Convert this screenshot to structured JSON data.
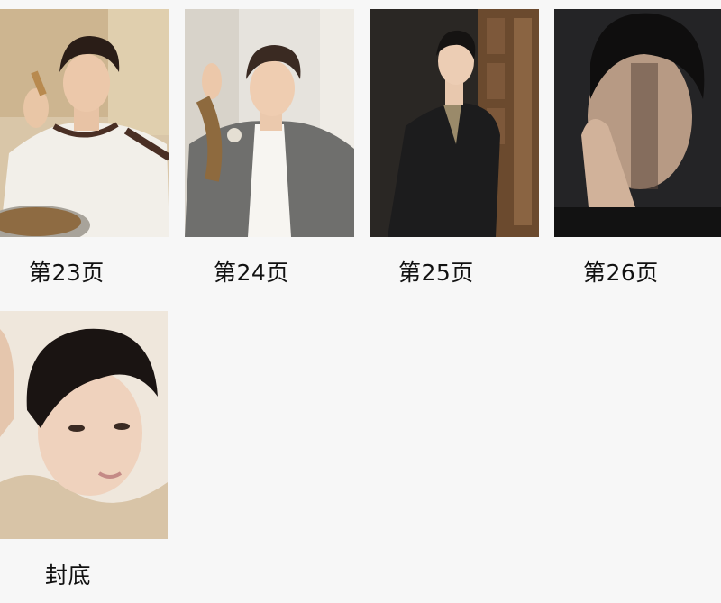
{
  "pages": [
    {
      "label": "第23页",
      "photo": "page-23-photo"
    },
    {
      "label": "第24页",
      "photo": "page-24-photo"
    },
    {
      "label": "第25页",
      "photo": "page-25-photo"
    },
    {
      "label": "第26页",
      "photo": "page-26-photo"
    },
    {
      "label": "封底",
      "photo": "back-cover-photo"
    }
  ]
}
